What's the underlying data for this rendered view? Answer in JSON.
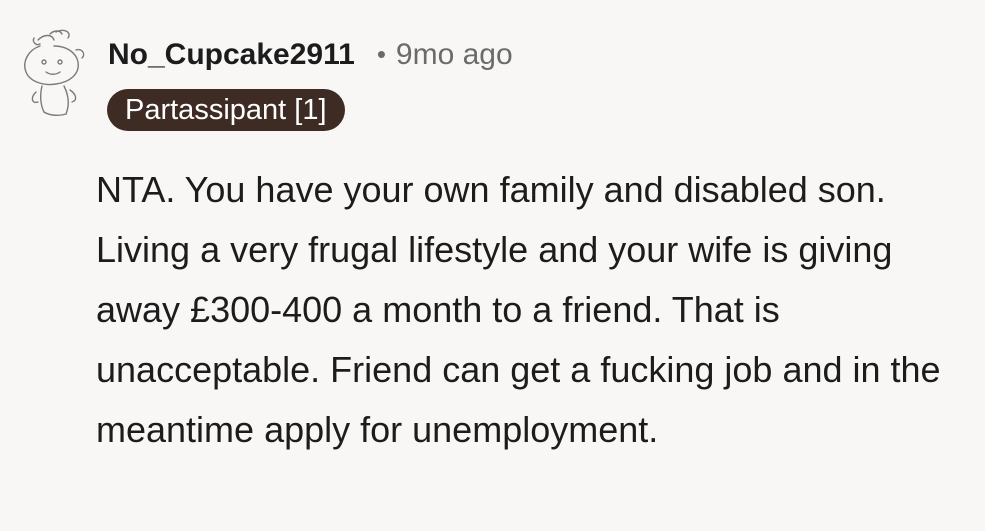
{
  "comment": {
    "author": "No_Cupcake2911",
    "separator": "•",
    "timestamp": "9mo ago",
    "flair": "Partassipant [1]",
    "avatar_icon": "snoo-avatar-icon",
    "text": "NTA. You have your own family and disabled son. Living a very frugal lifestyle and your wife is giving away £300-400 a month to a friend. That is unacceptable. Friend can get a fucking job and in the meantime apply for unemployment."
  },
  "colors": {
    "background": "#f8f7f6",
    "text": "#1c1c1c",
    "meta": "#6b6b6b",
    "flair_bg": "#3d2b24",
    "flair_text": "#ffffff"
  }
}
